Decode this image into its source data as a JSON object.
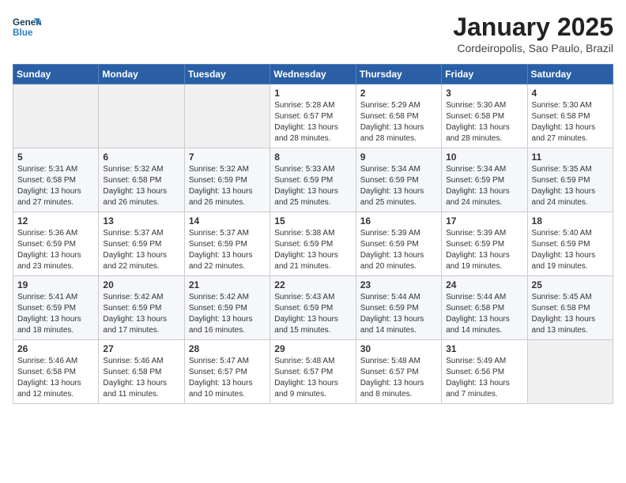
{
  "header": {
    "logo_line1": "General",
    "logo_line2": "Blue",
    "month_title": "January 2025",
    "location": "Cordeiropolis, Sao Paulo, Brazil"
  },
  "weekdays": [
    "Sunday",
    "Monday",
    "Tuesday",
    "Wednesday",
    "Thursday",
    "Friday",
    "Saturday"
  ],
  "weeks": [
    [
      {
        "day": "",
        "info": ""
      },
      {
        "day": "",
        "info": ""
      },
      {
        "day": "",
        "info": ""
      },
      {
        "day": "1",
        "info": "Sunrise: 5:28 AM\nSunset: 6:57 PM\nDaylight: 13 hours\nand 28 minutes."
      },
      {
        "day": "2",
        "info": "Sunrise: 5:29 AM\nSunset: 6:58 PM\nDaylight: 13 hours\nand 28 minutes."
      },
      {
        "day": "3",
        "info": "Sunrise: 5:30 AM\nSunset: 6:58 PM\nDaylight: 13 hours\nand 28 minutes."
      },
      {
        "day": "4",
        "info": "Sunrise: 5:30 AM\nSunset: 6:58 PM\nDaylight: 13 hours\nand 27 minutes."
      }
    ],
    [
      {
        "day": "5",
        "info": "Sunrise: 5:31 AM\nSunset: 6:58 PM\nDaylight: 13 hours\nand 27 minutes."
      },
      {
        "day": "6",
        "info": "Sunrise: 5:32 AM\nSunset: 6:58 PM\nDaylight: 13 hours\nand 26 minutes."
      },
      {
        "day": "7",
        "info": "Sunrise: 5:32 AM\nSunset: 6:59 PM\nDaylight: 13 hours\nand 26 minutes."
      },
      {
        "day": "8",
        "info": "Sunrise: 5:33 AM\nSunset: 6:59 PM\nDaylight: 13 hours\nand 25 minutes."
      },
      {
        "day": "9",
        "info": "Sunrise: 5:34 AM\nSunset: 6:59 PM\nDaylight: 13 hours\nand 25 minutes."
      },
      {
        "day": "10",
        "info": "Sunrise: 5:34 AM\nSunset: 6:59 PM\nDaylight: 13 hours\nand 24 minutes."
      },
      {
        "day": "11",
        "info": "Sunrise: 5:35 AM\nSunset: 6:59 PM\nDaylight: 13 hours\nand 24 minutes."
      }
    ],
    [
      {
        "day": "12",
        "info": "Sunrise: 5:36 AM\nSunset: 6:59 PM\nDaylight: 13 hours\nand 23 minutes."
      },
      {
        "day": "13",
        "info": "Sunrise: 5:37 AM\nSunset: 6:59 PM\nDaylight: 13 hours\nand 22 minutes."
      },
      {
        "day": "14",
        "info": "Sunrise: 5:37 AM\nSunset: 6:59 PM\nDaylight: 13 hours\nand 22 minutes."
      },
      {
        "day": "15",
        "info": "Sunrise: 5:38 AM\nSunset: 6:59 PM\nDaylight: 13 hours\nand 21 minutes."
      },
      {
        "day": "16",
        "info": "Sunrise: 5:39 AM\nSunset: 6:59 PM\nDaylight: 13 hours\nand 20 minutes."
      },
      {
        "day": "17",
        "info": "Sunrise: 5:39 AM\nSunset: 6:59 PM\nDaylight: 13 hours\nand 19 minutes."
      },
      {
        "day": "18",
        "info": "Sunrise: 5:40 AM\nSunset: 6:59 PM\nDaylight: 13 hours\nand 19 minutes."
      }
    ],
    [
      {
        "day": "19",
        "info": "Sunrise: 5:41 AM\nSunset: 6:59 PM\nDaylight: 13 hours\nand 18 minutes."
      },
      {
        "day": "20",
        "info": "Sunrise: 5:42 AM\nSunset: 6:59 PM\nDaylight: 13 hours\nand 17 minutes."
      },
      {
        "day": "21",
        "info": "Sunrise: 5:42 AM\nSunset: 6:59 PM\nDaylight: 13 hours\nand 16 minutes."
      },
      {
        "day": "22",
        "info": "Sunrise: 5:43 AM\nSunset: 6:59 PM\nDaylight: 13 hours\nand 15 minutes."
      },
      {
        "day": "23",
        "info": "Sunrise: 5:44 AM\nSunset: 6:59 PM\nDaylight: 13 hours\nand 14 minutes."
      },
      {
        "day": "24",
        "info": "Sunrise: 5:44 AM\nSunset: 6:58 PM\nDaylight: 13 hours\nand 14 minutes."
      },
      {
        "day": "25",
        "info": "Sunrise: 5:45 AM\nSunset: 6:58 PM\nDaylight: 13 hours\nand 13 minutes."
      }
    ],
    [
      {
        "day": "26",
        "info": "Sunrise: 5:46 AM\nSunset: 6:58 PM\nDaylight: 13 hours\nand 12 minutes."
      },
      {
        "day": "27",
        "info": "Sunrise: 5:46 AM\nSunset: 6:58 PM\nDaylight: 13 hours\nand 11 minutes."
      },
      {
        "day": "28",
        "info": "Sunrise: 5:47 AM\nSunset: 6:57 PM\nDaylight: 13 hours\nand 10 minutes."
      },
      {
        "day": "29",
        "info": "Sunrise: 5:48 AM\nSunset: 6:57 PM\nDaylight: 13 hours\nand 9 minutes."
      },
      {
        "day": "30",
        "info": "Sunrise: 5:48 AM\nSunset: 6:57 PM\nDaylight: 13 hours\nand 8 minutes."
      },
      {
        "day": "31",
        "info": "Sunrise: 5:49 AM\nSunset: 6:56 PM\nDaylight: 13 hours\nand 7 minutes."
      },
      {
        "day": "",
        "info": ""
      }
    ]
  ]
}
